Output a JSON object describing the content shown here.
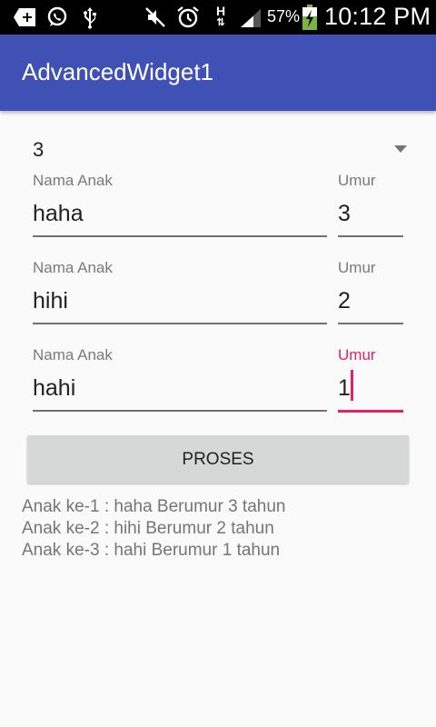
{
  "status_bar": {
    "icons": [
      "add-box-icon",
      "whatsapp-icon",
      "usb-icon",
      "mute-icon",
      "alarm-icon",
      "data-h-icon",
      "signal-icon",
      "battery-charging-icon"
    ],
    "battery_percent": "57%",
    "time": "10:12 PM"
  },
  "app_bar": {
    "title": "AdvancedWidget1",
    "color": "#3f51b5"
  },
  "spinner": {
    "selected": "3"
  },
  "children": [
    {
      "name_label": "Nama Anak",
      "name_value": "haha",
      "age_label": "Umur",
      "age_value": "3",
      "focused": false
    },
    {
      "name_label": "Nama Anak",
      "name_value": "hihi",
      "age_label": "Umur",
      "age_value": "2",
      "focused": false
    },
    {
      "name_label": "Nama Anak",
      "name_value": "hahi",
      "age_label": "Umur",
      "age_value": "1",
      "focused": true
    }
  ],
  "process_button": {
    "label": "PROSES"
  },
  "results": [
    "Anak ke-1 : haha Berumur 3 tahun",
    "Anak ke-2 : hihi Berumur 2 tahun",
    "Anak ke-3 : hahi Berumur 1 tahun"
  ],
  "colors": {
    "accent": "#e91e63",
    "primary": "#3f51b5",
    "button_bg": "#d6d7d7"
  }
}
